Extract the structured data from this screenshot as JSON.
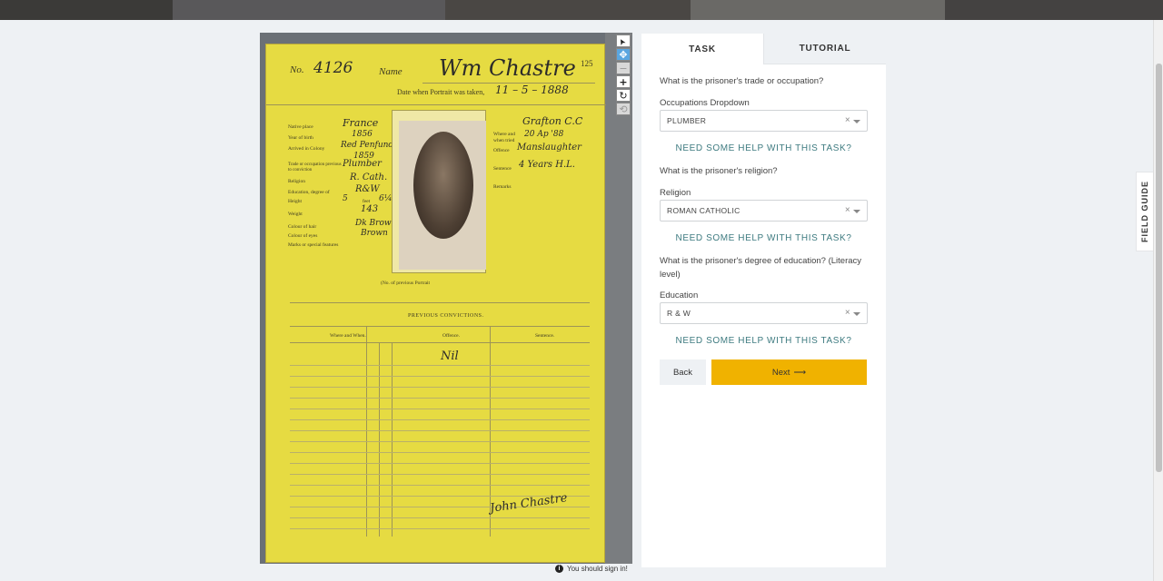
{
  "card": {
    "form_no": "No.",
    "number": "4126",
    "name_label": "Name",
    "name": "Wm Chastre",
    "page": "125",
    "date_label": "Date when Portrait was taken,",
    "date": "11 – 5 – 1888",
    "native_place_label": "Native place",
    "native_place": "France",
    "year_birth_label": "Year of birth",
    "year_birth": "1856",
    "arrived_label": "Arrived in Colony",
    "ship": "Red Penfund",
    "year": "1859",
    "trade_label": "Trade or occupation previous to conviction",
    "trade": "Plumber",
    "religion_label": "Religion",
    "religion": "R. Cath.",
    "education_label": "Education, degree of",
    "education": "R&W",
    "height_label": "Height",
    "feet": "5",
    "feet_label": "feet",
    "inches": "6¼",
    "inches_label": "inches",
    "weight_label": "Weight",
    "weight": "143",
    "hair_label": "Colour of hair",
    "hair": "Dk Brown",
    "eyes_label": "Colour of eyes",
    "eyes": "Brown",
    "marks_label": "Marks or special features",
    "where_label": "Where and when tried",
    "where": "Grafton C.C",
    "when": "20 Ap '88",
    "offence_label": "Offence",
    "offence": "Manslaughter",
    "sentence_label": "Sentence",
    "sentence": "4 Years H.L.",
    "remarks_label": "Remarks",
    "prev_portrait": "(No. of previous Portrait",
    "prev_convictions": "PREVIOUS CONVICTIONS.",
    "col_where": "Where and When.",
    "col_offence": "Offence.",
    "col_sentence": "Sentence.",
    "nil": "Nil",
    "signature": "John Chastre"
  },
  "viewer_tools": [
    {
      "name": "pointer-tool",
      "icon": "pointer-icon",
      "glyph": "➤"
    },
    {
      "name": "move-tool",
      "icon": "move-icon",
      "glyph": "✥"
    },
    {
      "name": "zoom-out-tool",
      "icon": "minus-icon",
      "glyph": "−"
    },
    {
      "name": "zoom-in-tool",
      "icon": "plus-icon",
      "glyph": "+"
    },
    {
      "name": "rotate-tool",
      "icon": "rotate-icon",
      "glyph": "↻"
    },
    {
      "name": "reset-tool",
      "icon": "reset-icon",
      "glyph": "⟲"
    }
  ],
  "signin_notice": "You should sign in!",
  "tabs": {
    "task": "TASK",
    "tutorial": "TUTORIAL"
  },
  "task": {
    "q1": "What is the prisoner's trade or occupation?",
    "dropdown1_label": "Occupations Dropdown",
    "dropdown1_value": "PLUMBER",
    "help": "NEED SOME HELP WITH THIS TASK?",
    "q2": "What is the prisoner's religion?",
    "dropdown2_label": "Religion",
    "dropdown2_value": "ROMAN CATHOLIC",
    "q3": "What is the prisoner's degree of education? (Literacy level)",
    "dropdown3_label": "Education",
    "dropdown3_value": "R & W",
    "clear": "×",
    "back": "Back",
    "next": "Next",
    "next_arrow": "⟶"
  },
  "field_guide": "FIELD GUIDE",
  "colors": {
    "accent": "#f0b200",
    "help_link": "#3e7b80",
    "card": "#e6db42"
  }
}
